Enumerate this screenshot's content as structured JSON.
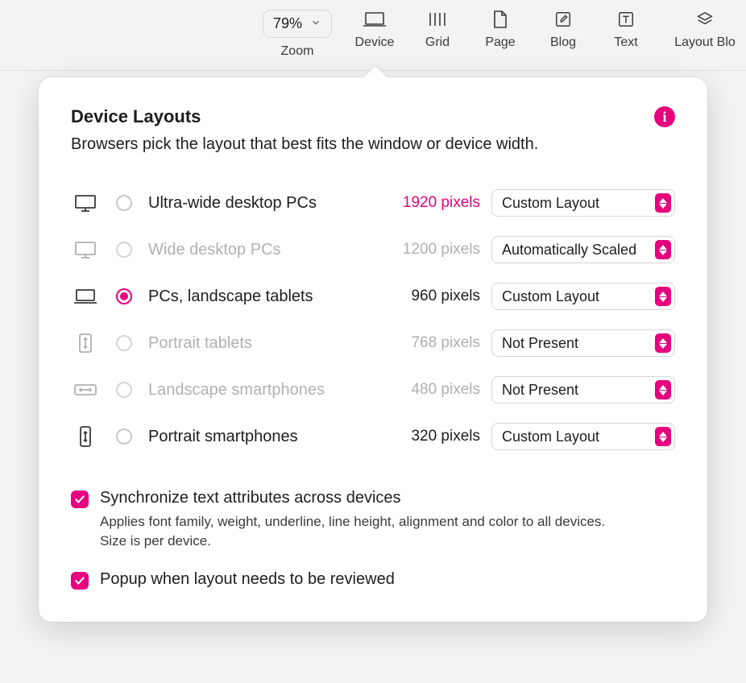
{
  "toolbar": {
    "zoom": {
      "value": "79%",
      "label": "Zoom"
    },
    "items": [
      {
        "label": "Device"
      },
      {
        "label": "Grid"
      },
      {
        "label": "Page"
      },
      {
        "label": "Blog"
      },
      {
        "label": "Text"
      },
      {
        "label": "Layout Blo"
      }
    ]
  },
  "popover": {
    "title": "Device Layouts",
    "description": "Browsers pick the layout that best fits the window or device width.",
    "info_tooltip": "i"
  },
  "layouts": [
    {
      "name": "Ultra-wide desktop PCs",
      "pixels": "1920 pixels",
      "mode": "Custom Layout",
      "selected": false,
      "disabled": false,
      "px_accent": true,
      "icon": "desktop"
    },
    {
      "name": "Wide desktop PCs",
      "pixels": "1200 pixels",
      "mode": "Automatically Scaled",
      "selected": false,
      "disabled": true,
      "px_accent": true,
      "icon": "desktop"
    },
    {
      "name": "PCs, landscape tablets",
      "pixels": "960 pixels",
      "mode": "Custom Layout",
      "selected": true,
      "disabled": false,
      "px_accent": false,
      "icon": "laptop"
    },
    {
      "name": "Portrait tablets",
      "pixels": "768 pixels",
      "mode": "Not Present",
      "selected": false,
      "disabled": true,
      "px_accent": false,
      "icon": "tablet-portrait"
    },
    {
      "name": "Landscape smartphones",
      "pixels": "480 pixels",
      "mode": "Not Present",
      "selected": false,
      "disabled": true,
      "px_accent": false,
      "icon": "phone-landscape"
    },
    {
      "name": "Portrait smartphones",
      "pixels": "320 pixels",
      "mode": "Custom Layout",
      "selected": false,
      "disabled": false,
      "px_accent": false,
      "icon": "phone-portrait"
    }
  ],
  "checks": {
    "sync": {
      "label": "Synchronize text attributes across devices",
      "sub": "Applies font family, weight, underline, line height, alignment and color to all devices. Size is per device.",
      "checked": true
    },
    "popup": {
      "label": "Popup when layout needs to be reviewed",
      "checked": true
    }
  },
  "colors": {
    "accent": "#e6007e"
  }
}
